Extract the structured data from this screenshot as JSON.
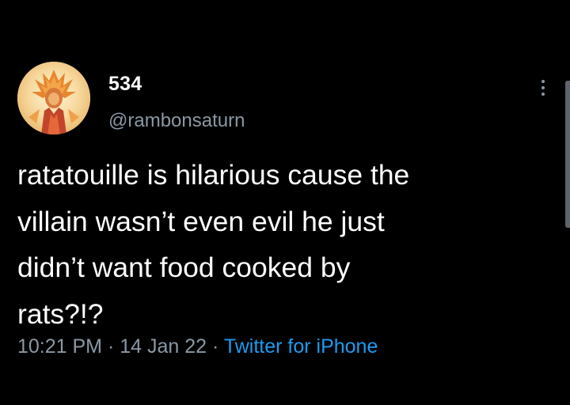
{
  "user": {
    "display_name": "534",
    "handle": "@rambonsaturn"
  },
  "tweet": {
    "lines": [
      "ratatouille is hilarious cause the",
      "villain wasn’t even evil he just",
      "didn’t want food cooked by",
      "rats?!?"
    ],
    "time": "10:21 PM",
    "date": "14 Jan 22",
    "source": "Twitter for iPhone",
    "separator": " · "
  },
  "icons": {
    "more": "more-options-icon",
    "avatar": "user-avatar"
  },
  "colors": {
    "background": "#000000",
    "text": "#ffffff",
    "secondary": "#8b98a5",
    "link": "#1d9bf0"
  }
}
